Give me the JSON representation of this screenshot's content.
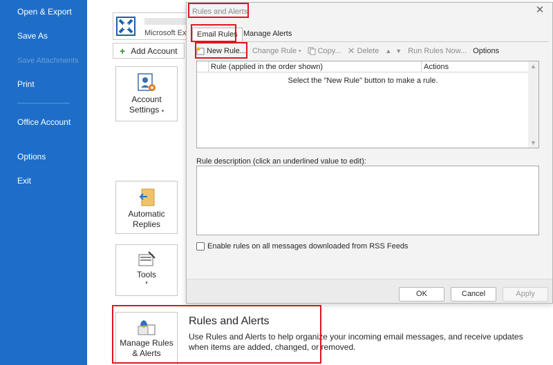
{
  "sidebar": {
    "items": [
      {
        "label": "Open & Export"
      },
      {
        "label": "Save As"
      },
      {
        "label": "Save Attachments"
      },
      {
        "label": "Print"
      },
      {
        "label": "Office Account"
      },
      {
        "label": "Options"
      },
      {
        "label": "Exit"
      }
    ]
  },
  "account": {
    "name": "Microsoft Ex",
    "add_label": "Add Account",
    "settings_label": "Account Settings",
    "auto_replies_label": "Automatic Replies",
    "tools_label": "Tools",
    "manage_rules_label": "Manage Rules & Alerts",
    "rules_title": "Rules and Alerts",
    "rules_desc": "Use Rules and Alerts to help organize your incoming email messages, and receive updates when items are added, changed, or removed."
  },
  "dialog": {
    "title": "Rules and Alerts",
    "tabs": [
      "Email Rules",
      "Manage Alerts"
    ],
    "toolbar": {
      "new_rule": "New Rule...",
      "change_rule": "Change Rule",
      "copy": "Copy...",
      "delete": "Delete",
      "run_rules": "Run Rules Now...",
      "options": "Options"
    },
    "list": {
      "col_rule": "Rule (applied in the order shown)",
      "col_actions": "Actions",
      "empty_text": "Select the \"New Rule\" button to make a rule."
    },
    "description_label": "Rule description (click an underlined value to edit):",
    "rss_label": "Enable rules on all messages downloaded from RSS Feeds",
    "buttons": {
      "ok": "OK",
      "cancel": "Cancel",
      "apply": "Apply"
    }
  },
  "colors": {
    "sidebar_bg": "#1e6ec8",
    "highlight": "#e0141e"
  }
}
